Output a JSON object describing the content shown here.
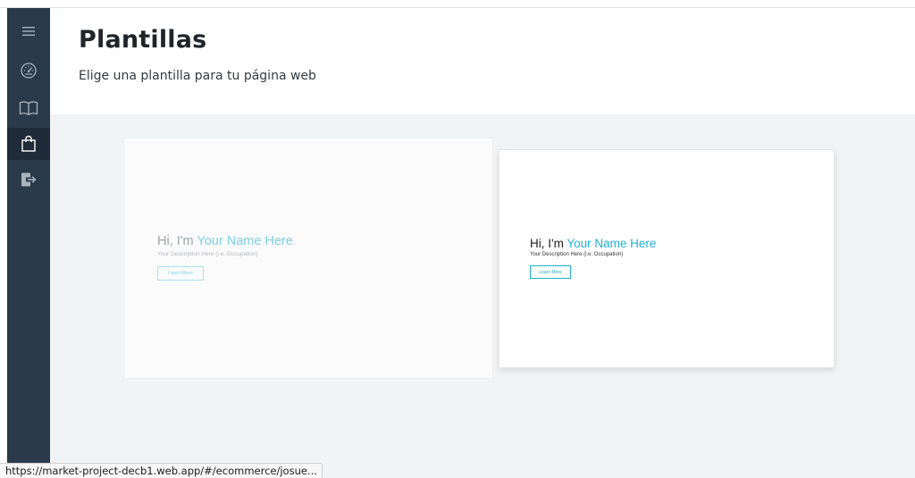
{
  "sidebar": {
    "items": [
      {
        "icon": "menu-icon",
        "active": false
      },
      {
        "icon": "dashboard-icon",
        "active": false
      },
      {
        "icon": "book-icon",
        "active": false
      },
      {
        "icon": "shopping-bag-icon",
        "active": true
      },
      {
        "icon": "logout-icon",
        "active": false
      }
    ],
    "icon_color": "#aab4bf",
    "active_icon_color": "#ffffff",
    "background": "#2b3a4a"
  },
  "header": {
    "title": "Plantillas",
    "subtitle": "Elige una plantilla para tu página web"
  },
  "templates": [
    {
      "greeting": "Hi, I'm ",
      "name": "Your Name Here",
      "description": "Your Description Here (i.e. Occupation)",
      "button_label": "Learn More"
    },
    {
      "greeting": "Hi, I'm ",
      "name": "Your Name Here",
      "description": "Your Description Here (i.e. Occupation)",
      "button_label": "Learn More"
    }
  ],
  "status_bar": {
    "url": "https://market-project-decb1.web.app/#/ecommerce/josue..."
  },
  "colors": {
    "accent": "#1fb0cf",
    "content_background": "#f2f3f4"
  }
}
